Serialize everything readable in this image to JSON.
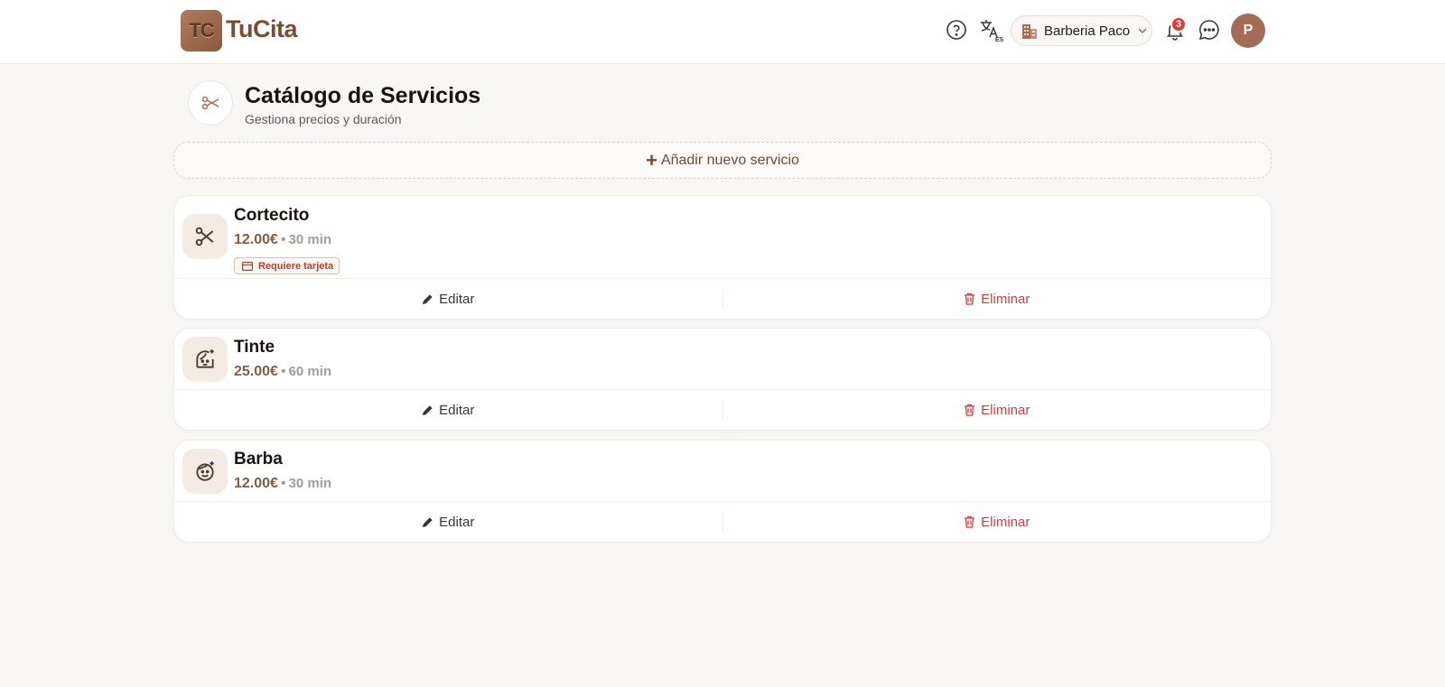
{
  "app": {
    "logo_text": "TuCita",
    "logo_mark": "TC"
  },
  "header": {
    "business_label": "Barberia Paco",
    "notifications_count": "3",
    "avatar_initial": "P",
    "icons": [
      "help-icon",
      "translate-icon",
      "building-icon",
      "chevron-down-icon",
      "bell-icon",
      "chat-icon"
    ],
    "translate_badge": "ES"
  },
  "page": {
    "title": "Catálogo de Servicios",
    "subtitle": "Gestiona precios y duración",
    "add_button_label": "Añadir nuevo servicio"
  },
  "services": [
    {
      "name": "Cortecito",
      "price": "12.00€",
      "duration": "30 min",
      "tag": "Requiere tarjeta",
      "icon": "scissors-icon"
    },
    {
      "name": "Tinte",
      "price": "25.00€",
      "duration": "60 min",
      "tag": "",
      "icon": "hair-dye-icon"
    },
    {
      "name": "Barba",
      "price": "12.00€",
      "duration": "30 min",
      "tag": "",
      "icon": "beard-face-icon"
    }
  ],
  "actions": {
    "edit_label": "Editar",
    "delete_label": "Eliminar"
  },
  "colors": {
    "brand": "#8a5a41",
    "danger": "#d63b3b",
    "badge": "#e53935"
  }
}
